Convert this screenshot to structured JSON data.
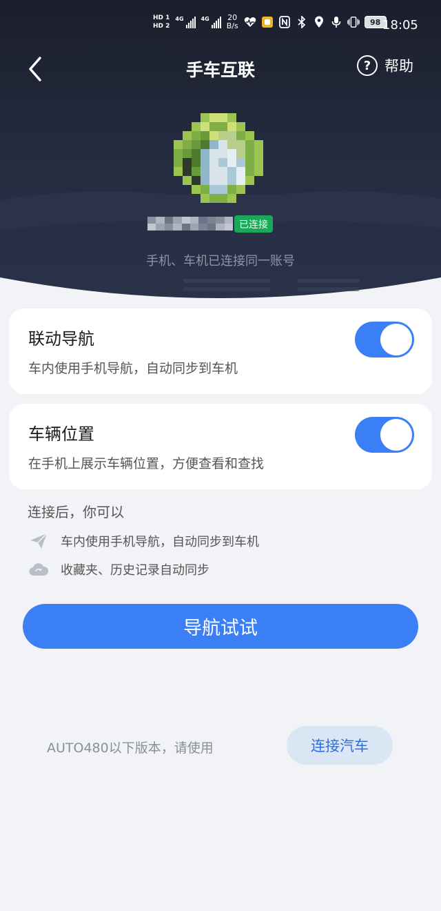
{
  "status_bar": {
    "hd1": "HD 1",
    "hd2": "HD 2",
    "net1": "4G",
    "net2": "4G",
    "speed_value": "20",
    "speed_unit": "B/s",
    "battery": "98",
    "time": "18:05"
  },
  "header": {
    "title": "手车互联",
    "help_label": "帮助"
  },
  "device": {
    "status_badge": "已连接",
    "subtitle": "手机、车机已连接同一账号"
  },
  "settings": [
    {
      "title": "联动导航",
      "description": "车内使用手机导航，自动同步到车机",
      "enabled": true
    },
    {
      "title": "车辆位置",
      "description": "在手机上展示车辆位置，方便查看和查找",
      "enabled": true
    }
  ],
  "features": {
    "heading": "连接后，你可以",
    "items": [
      {
        "icon": "paper-plane-icon",
        "text": "车内使用手机导航，自动同步到车机"
      },
      {
        "icon": "cloud-icon",
        "text": "收藏夹、历史记录自动同步"
      }
    ]
  },
  "primary_button": "导航试试",
  "footer": {
    "note": "AUTO480以下版本，请使用",
    "connect_button": "连接汽车"
  },
  "colors": {
    "accent": "#3a7ff6",
    "header_bg": "#1c2233",
    "badge": "#1aa95a",
    "page_bg": "#f1f3f6"
  }
}
